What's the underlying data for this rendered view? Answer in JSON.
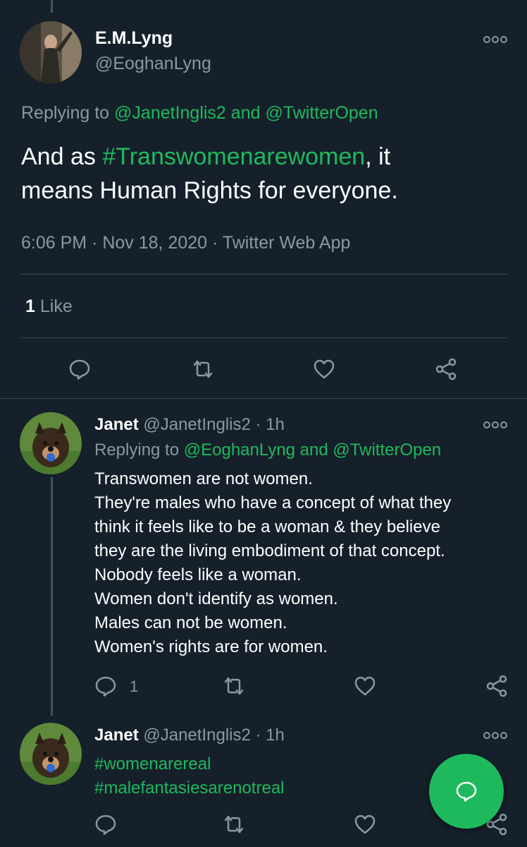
{
  "tweet": {
    "author_name": "E.M.Lyng",
    "author_handle": "@EoghanLyng",
    "replying_prefix": "Replying to ",
    "replying_user1": "@JanetInglis2",
    "replying_and": " and ",
    "replying_user2": "@TwitterOpen",
    "text_part1": "And as ",
    "hashtag": "#Transwomenarewomen",
    "text_part2": ", it",
    "text_line2": "means Human Rights for everyone.",
    "meta": "6:06 PM · Nov 18, 2020 · Twitter Web App",
    "likes_count": "1",
    "likes_label": "Like"
  },
  "reply1": {
    "name": "Janet",
    "handle_time": "@JanetInglis2 · 1h",
    "replying_prefix": "Replying to ",
    "replying_user1": "@EoghanLyng",
    "replying_and": " and ",
    "replying_user2": "@TwitterOpen",
    "lines": [
      "Transwomen are not women.",
      "They're males who have a concept of what they",
      "think it feels like to be a woman & they believe",
      "they are the living embodiment of that concept.",
      "Nobody feels like a woman.",
      "Women don't identify as women.",
      "Males can not be women.",
      "Women's rights are for women."
    ],
    "reply_count": "1"
  },
  "reply2": {
    "name": "Janet",
    "handle_time": "@JanetInglis2 · 1h",
    "hashtag1": "#womenarereal",
    "hashtag2": "#malefantasiesarenotreal"
  },
  "colors": {
    "background": "#15202b",
    "accent": "#1fb95d",
    "muted": "#8899a6",
    "divider": "#38444d"
  },
  "icons": [
    "more-icon",
    "reply-icon",
    "retweet-icon",
    "like-icon",
    "share-icon",
    "compose-icon"
  ]
}
